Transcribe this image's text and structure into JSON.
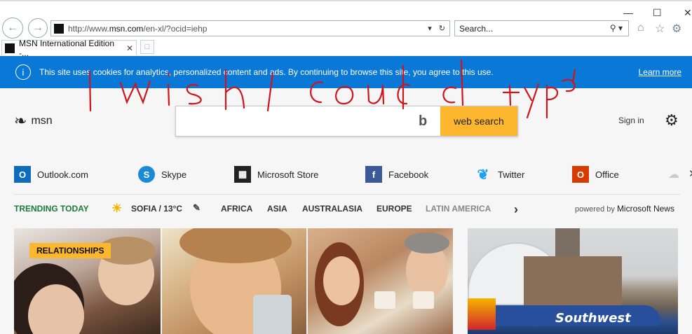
{
  "browser": {
    "url_prefix": "http://www.",
    "url_domain": "msn.com",
    "url_path": "/en-xl/?ocid=iehp",
    "search_placeholder": "Search...",
    "tab_title": "MSN International Edition -...",
    "window_controls": {
      "minimize": "—",
      "maximize": "☐",
      "close": "✕"
    }
  },
  "cookie_banner": {
    "message": "This site uses cookies for analytics, personalized content and ads. By continuing to browse this site, you agree to this use.",
    "learn_more": "Learn more",
    "colors": {
      "background": "#0a78d7"
    }
  },
  "header": {
    "logo_text": "msn",
    "search_button": "web search",
    "sign_in": "Sign in"
  },
  "quick_links": [
    {
      "label": "Outlook.com",
      "icon": "outlook-icon",
      "color": "#0f6cbd"
    },
    {
      "label": "Skype",
      "icon": "skype-icon",
      "color": "#1b8ad6"
    },
    {
      "label": "Microsoft Store",
      "icon": "store-icon",
      "color": "#222222"
    },
    {
      "label": "Facebook",
      "icon": "facebook-icon",
      "color": "#3b5998"
    },
    {
      "label": "Twitter",
      "icon": "twitter-icon",
      "color": "#1da1f2"
    },
    {
      "label": "Office",
      "icon": "office-icon",
      "color": "#d83b01"
    }
  ],
  "trending": {
    "label": "TRENDING TODAY",
    "weather": "SOFIA / 13°C",
    "categories": [
      "AFRICA",
      "ASIA",
      "AUSTRALASIA",
      "EUROPE",
      "LATIN AMERICA"
    ],
    "powered_by": "powered by",
    "powered_brand": "Microsoft News",
    "colors": {
      "label": "#1a7b3c"
    }
  },
  "cards": {
    "first_tag": "RELATIONSHIPS",
    "plane_text": "Southwest"
  },
  "annotation": {
    "handwritten_text": "I wish I could type"
  }
}
